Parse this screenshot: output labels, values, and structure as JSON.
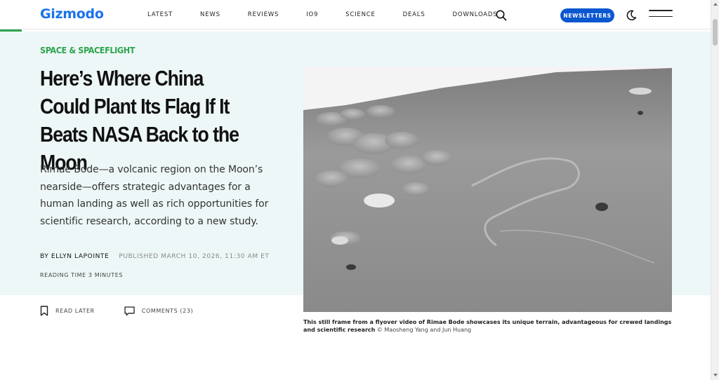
{
  "header": {
    "logo": "Gizmodo",
    "nav": [
      "LATEST",
      "NEWS",
      "REVIEWS",
      "IO9",
      "SCIENCE",
      "DEALS",
      "DOWNLOADS"
    ],
    "newsletter_label": "NEWSLETTERS",
    "icons": {
      "search": "search-icon",
      "theme": "moon-icon",
      "menu": "hamburger-menu-icon"
    }
  },
  "article": {
    "category": "SPACE & SPACEFLIGHT",
    "title": "Here’s Where China Could Plant Its Flag If It Beats NASA Back to the Moon",
    "dek": "Rimae Bode—a volcanic region on the Moon’s nearside—offers strategic advantages for a human landing as well as rich opportunities for scientific research, according to a new study.",
    "author": "BY ELLYN LAPOINTE",
    "published": "PUBLISHED MARCH 10, 2026, 11:30 AM ET",
    "reading_time": "READING TIME 3 MINUTES",
    "read_later": "READ LATER",
    "comments": "COMMENTS (23)",
    "caption_main": "This still frame from a flyover video of Rimae Bode showcases its unique terrain, advantageous for crewed landings and scientific research",
    "caption_credit": "© Maosheng Yang and Jun Huang"
  },
  "colors": {
    "brand_blue": "#1a73e8",
    "button_blue": "#0b57d0",
    "accent_green": "#2ea44f",
    "hero_bg": "#eef7f7"
  }
}
